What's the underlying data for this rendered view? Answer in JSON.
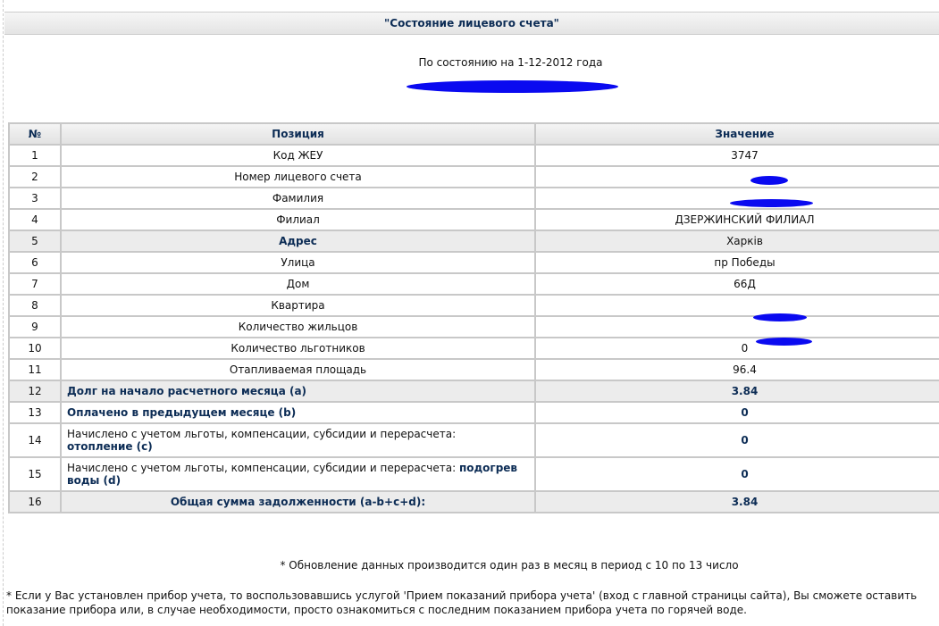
{
  "title": "\"Состояние лицевого счета\"",
  "as_of": "По состоянию на 1-12-2012 года",
  "headers": {
    "num": "№",
    "position": "Позиция",
    "value": "Значение"
  },
  "rows": [
    {
      "n": "1",
      "label": "Код ЖЕУ",
      "value": "3747"
    },
    {
      "n": "2",
      "label": "Номер лицевого счета",
      "value": ""
    },
    {
      "n": "3",
      "label": "Фамилия",
      "value": ""
    },
    {
      "n": "4",
      "label": "Филиал",
      "value": "ДЗЕРЖИНСКИЙ ФИЛИАЛ"
    },
    {
      "n": "5",
      "label": "Адрес",
      "value": "Харків"
    },
    {
      "n": "6",
      "label": "Улица",
      "value": "пр   Победы"
    },
    {
      "n": "7",
      "label": "Дом",
      "value": "66Д"
    },
    {
      "n": "8",
      "label": "Квартира",
      "value": ""
    },
    {
      "n": "9",
      "label": "Количество жильцов",
      "value": ""
    },
    {
      "n": "10",
      "label": "Количество льготников",
      "value": "0"
    },
    {
      "n": "11",
      "label": "Отапливаемая площадь",
      "value": "96.4"
    },
    {
      "n": "12",
      "label": "Долг на начало расчетного месяца (a)",
      "value": "3.84"
    },
    {
      "n": "13",
      "label": "Оплачено в предыдущем месяце (b)",
      "value": "0"
    },
    {
      "n": "14",
      "label": "Начислено с учетом льготы, компенсации, субсидии и перерасчета:",
      "label_bold": "отопление (c)",
      "value": "0"
    },
    {
      "n": "15",
      "label": "Начислено с учетом льготы, компенсации, субсидии и перерасчета:",
      "label_bold": "подогрев воды (d)",
      "value": "0"
    },
    {
      "n": "16",
      "label": "Общая сумма задолженности (a-b+c+d):",
      "value": "3.84"
    }
  ],
  "note1": "* Обновление данных производится один раз в месяц в период с 10 по 13 число",
  "note2": "* Если у Вас установлен прибор учета, то воспользовавшись услугой 'Прием показаний прибора учета' (вход с главной страницы сайта), Вы сможете оставить показание прибора или, в случае необходимости, просто ознакомиться с последним показанием прибора учета по горячей воде."
}
